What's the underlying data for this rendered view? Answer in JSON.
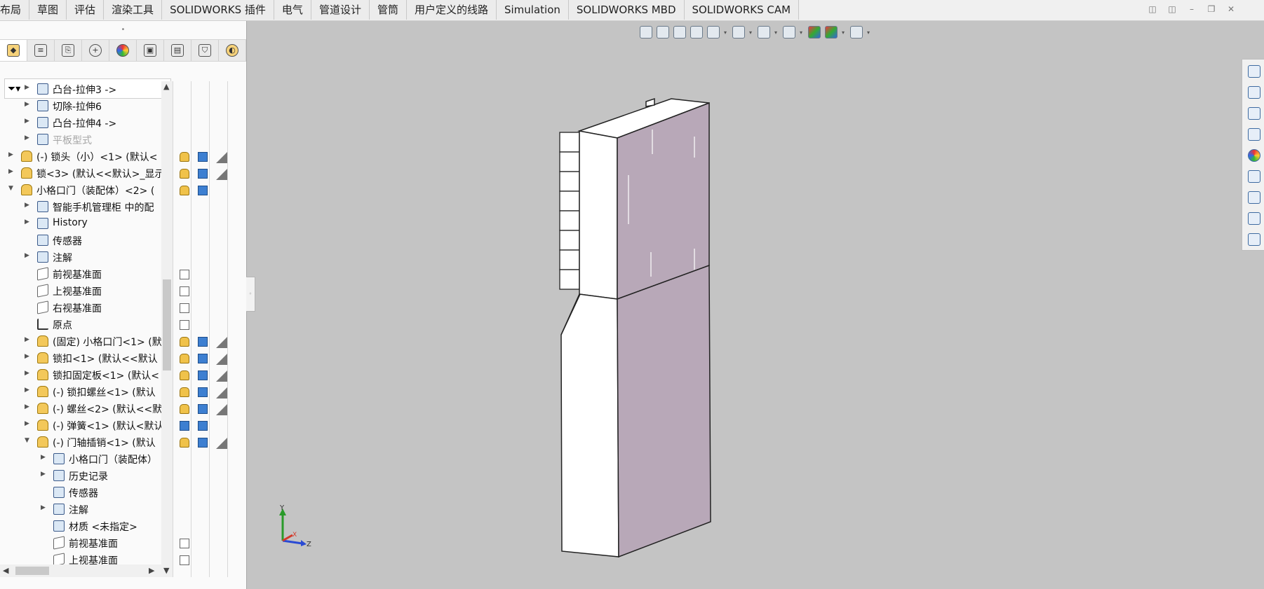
{
  "ribbon": {
    "tabs": [
      "布局",
      "草图",
      "评估",
      "渲染工具",
      "SOLIDWORKS 插件",
      "电气",
      "管道设计",
      "管筒",
      "用户定义的线路",
      "Simulation",
      "SOLIDWORKS MBD",
      "SOLIDWORKS CAM"
    ]
  },
  "feature_tree": {
    "items": [
      {
        "label": "凸台-拉伸3 ->",
        "depth": 1,
        "arrow": "collapsed",
        "icon": "extrude-icon",
        "dim": false
      },
      {
        "label": "切除-拉伸6",
        "depth": 1,
        "arrow": "collapsed",
        "icon": "cut-extrude-icon",
        "dim": false
      },
      {
        "label": "凸台-拉伸4 ->",
        "depth": 1,
        "arrow": "collapsed",
        "icon": "extrude-icon",
        "dim": false
      },
      {
        "label": "平板型式",
        "depth": 1,
        "arrow": "collapsed",
        "icon": "flat-pattern-icon",
        "dim": true
      },
      {
        "label": "(-) 锁头（小）<1> (默认<",
        "depth": 0,
        "arrow": "collapsed",
        "icon": "part-icon",
        "dim": false
      },
      {
        "label": "锁<3> (默认<<默认>_显示",
        "depth": 0,
        "arrow": "collapsed",
        "icon": "part-icon",
        "dim": false
      },
      {
        "label": "小格口门（装配体）<2> (",
        "depth": 0,
        "arrow": "expanded",
        "icon": "assembly-icon",
        "dim": false
      },
      {
        "label": "智能手机管理柜 中的配",
        "depth": 1,
        "arrow": "collapsed",
        "icon": "config-icon",
        "dim": false
      },
      {
        "label": "History",
        "depth": 1,
        "arrow": "collapsed",
        "icon": "history-icon",
        "dim": false
      },
      {
        "label": "传感器",
        "depth": 1,
        "arrow": "none",
        "icon": "sensor-icon",
        "dim": false
      },
      {
        "label": "注解",
        "depth": 1,
        "arrow": "collapsed",
        "icon": "annotation-icon",
        "dim": false
      },
      {
        "label": "前视基准面",
        "depth": 1,
        "arrow": "none",
        "icon": "plane-icon",
        "dim": false
      },
      {
        "label": "上视基准面",
        "depth": 1,
        "arrow": "none",
        "icon": "plane-icon",
        "dim": false
      },
      {
        "label": "右视基准面",
        "depth": 1,
        "arrow": "none",
        "icon": "plane-icon",
        "dim": false
      },
      {
        "label": "原点",
        "depth": 1,
        "arrow": "none",
        "icon": "origin-icon",
        "dim": false
      },
      {
        "label": "(固定) 小格口门<1> (默",
        "depth": 1,
        "arrow": "collapsed",
        "icon": "part-icon",
        "dim": false
      },
      {
        "label": "锁扣<1> (默认<<默认",
        "depth": 1,
        "arrow": "collapsed",
        "icon": "part-icon",
        "dim": false
      },
      {
        "label": "锁扣固定板<1> (默认<",
        "depth": 1,
        "arrow": "collapsed",
        "icon": "part-icon",
        "dim": false
      },
      {
        "label": "(-) 锁扣螺丝<1> (默认",
        "depth": 1,
        "arrow": "collapsed",
        "icon": "part-icon",
        "dim": false
      },
      {
        "label": "(-) 螺丝<2> (默认<<默",
        "depth": 1,
        "arrow": "collapsed",
        "icon": "part-icon",
        "dim": false
      },
      {
        "label": "(-) 弹簧<1> (默认<默认",
        "depth": 1,
        "arrow": "collapsed",
        "icon": "part-icon",
        "dim": false
      },
      {
        "label": "(-) 门轴插销<1> (默认",
        "depth": 1,
        "arrow": "expanded",
        "icon": "part-icon",
        "dim": false
      },
      {
        "label": "小格口门（装配体）",
        "depth": 2,
        "arrow": "collapsed",
        "icon": "config-icon",
        "dim": false
      },
      {
        "label": "历史记录",
        "depth": 2,
        "arrow": "collapsed",
        "icon": "history-icon",
        "dim": false
      },
      {
        "label": "传感器",
        "depth": 2,
        "arrow": "none",
        "icon": "sensor-icon",
        "dim": false
      },
      {
        "label": "注解",
        "depth": 2,
        "arrow": "collapsed",
        "icon": "annotation-icon",
        "dim": false
      },
      {
        "label": "材质 <未指定>",
        "depth": 2,
        "arrow": "none",
        "icon": "material-icon",
        "dim": false
      },
      {
        "label": "前视基准面",
        "depth": 2,
        "arrow": "none",
        "icon": "plane-icon",
        "dim": false
      },
      {
        "label": "上视基准面",
        "depth": 2,
        "arrow": "none",
        "icon": "plane-icon",
        "dim": false
      }
    ]
  },
  "triad": {
    "y": "Y",
    "x": "X",
    "z": "Z"
  },
  "colors": {
    "face_purple": "#b8a8b8",
    "face_white": "#ffffff",
    "viewport": "#c4c4c4"
  }
}
